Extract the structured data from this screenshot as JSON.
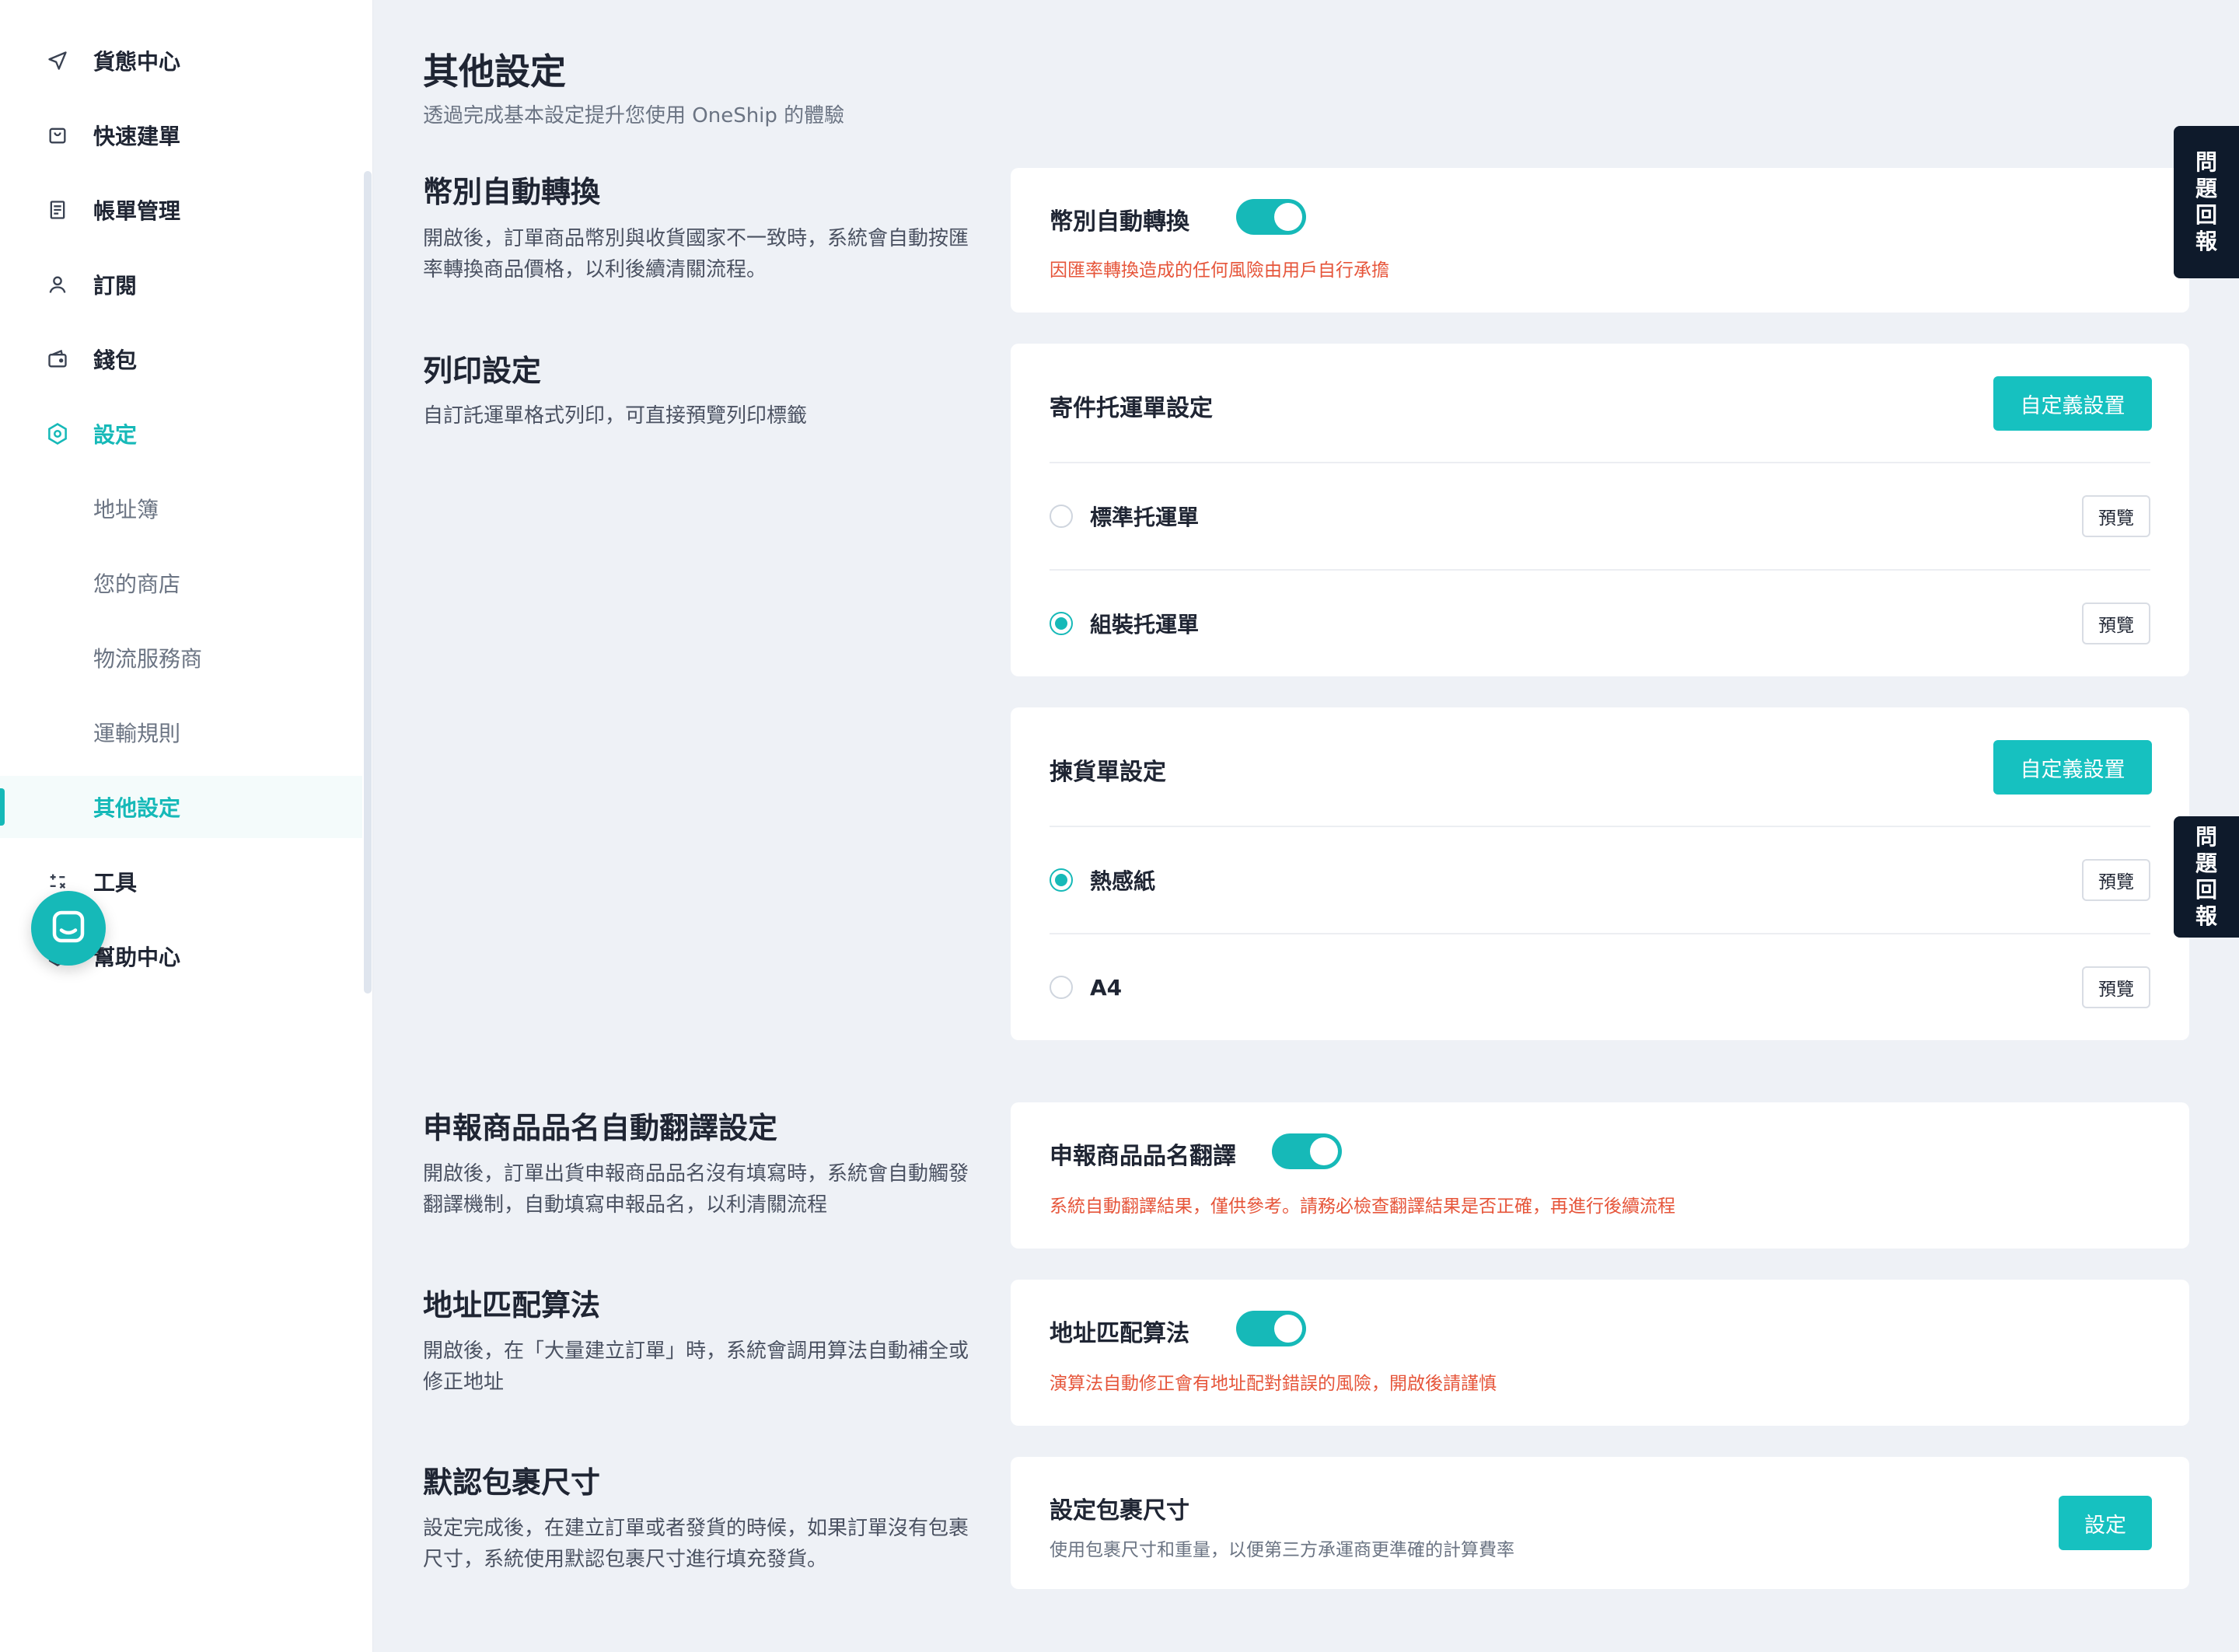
{
  "sidebar": {
    "items": [
      {
        "label": "貨態中心",
        "icon": "navigation-arrow-icon"
      },
      {
        "label": "快速建單",
        "icon": "shopping-bag-icon"
      },
      {
        "label": "帳單管理",
        "icon": "invoice-icon"
      },
      {
        "label": "訂閱",
        "icon": "user-icon"
      },
      {
        "label": "錢包",
        "icon": "wallet-icon"
      },
      {
        "label": "設定",
        "icon": "settings-hexagon-icon"
      }
    ],
    "settings_sub": [
      "地址簿",
      "您的商店",
      "物流服務商",
      "運輸規則",
      "其他設定"
    ],
    "tools_label": "工具",
    "help_label": "幫助中心"
  },
  "page": {
    "title": "其他設定",
    "subtitle": "透過完成基本設定提升您使用 OneShip 的體驗"
  },
  "sections": {
    "currency": {
      "title": "幣別自動轉換",
      "desc": "開啟後，訂單商品幣別與收貨國家不一致時，系統會自動按匯率轉換商品價格，以利後續清關流程。",
      "card_title": "幣別自動轉換",
      "enabled": true,
      "warning": "因匯率轉換造成的任何風險由用戶自行承擔"
    },
    "print": {
      "title": "列印設定",
      "desc": "自訂託運單格式列印，可直接預覽列印標籤",
      "waybill": {
        "title": "寄件托運單設定",
        "custom_button": "自定義設置",
        "options": [
          {
            "label": "標準托運單",
            "checked": false,
            "preview": "預覽"
          },
          {
            "label": "組裝托運單",
            "checked": true,
            "preview": "預覽"
          }
        ]
      },
      "picking": {
        "title": "揀貨單設定",
        "custom_button": "自定義設置",
        "options": [
          {
            "label": "熱感紙",
            "checked": true,
            "preview": "預覽"
          },
          {
            "label": "A4",
            "checked": false,
            "preview": "預覽"
          }
        ]
      }
    },
    "translate": {
      "title": "申報商品品名自動翻譯設定",
      "desc": "開啟後，訂單出貨申報商品品名沒有填寫時，系統會自動觸發翻譯機制，自動填寫申報品名，以利清關流程",
      "card_title": "申報商品品名翻譯",
      "enabled": true,
      "warning": "系統自動翻譯結果，僅供參考。請務必檢查翻譯結果是否正確，再進行後續流程"
    },
    "address": {
      "title": "地址匹配算法",
      "desc": "開啟後，在「大量建立訂單」時，系統會調用算法自動補全或修正地址",
      "card_title": "地址匹配算法",
      "enabled": true,
      "warning": "演算法自動修正會有地址配對錯誤的風險，開啟後請謹慎"
    },
    "package": {
      "title": "默認包裹尺寸",
      "desc": "設定完成後，在建立訂單或者發貨的時候，如果訂單沒有包裹尺寸，系統使用默認包裹尺寸進行填充發貨。",
      "card_title": "設定包裹尺寸",
      "hint": "使用包裹尺寸和重量，以便第三方承運商更準確的計算費率",
      "button": "設定"
    }
  },
  "feedback": {
    "chars": [
      "問",
      "題",
      "回",
      "報"
    ]
  },
  "colors": {
    "accent": "#16b9b8",
    "warning": "#e6553a",
    "feedback_bg": "#0e1a2b"
  }
}
